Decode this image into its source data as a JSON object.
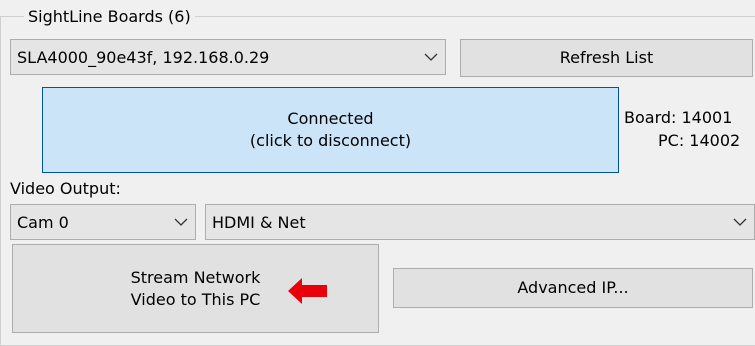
{
  "group": {
    "title": "SightLine Boards (6)"
  },
  "board_select": {
    "value": "SLA4000_90e43f, 192.168.0.29"
  },
  "refresh_button": {
    "label": "Refresh List"
  },
  "connect_button": {
    "line1": "Connected",
    "line2": "(click to disconnect)"
  },
  "ports": {
    "board": "Board: 14001",
    "pc": "PC: 14002"
  },
  "video_output": {
    "label": "Video Output:",
    "camera": "Cam 0",
    "output": "HDMI & Net"
  },
  "stream_button": {
    "line1": "Stream Network",
    "line2": "Video to This PC"
  },
  "advanced_button": {
    "label": "Advanced IP..."
  },
  "colors": {
    "connected_bg": "#cce4f7",
    "arrow": "#e8000b"
  },
  "icons": {
    "dropdown": "chevron-down-icon",
    "pointer": "arrow-left-icon"
  }
}
